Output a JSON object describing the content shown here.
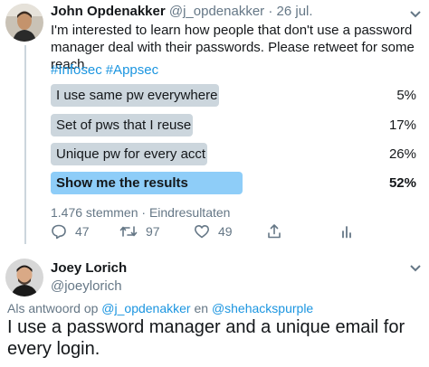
{
  "tweet": {
    "author_name": "John Opdenakker",
    "author_handle": "@j_opdenakker",
    "separator": "·",
    "date": "26 jul.",
    "text": "I'm interested to learn how people that don't use a password manager deal with their passwords. Please retweet for some reach.",
    "hashtags": [
      "#Infosec",
      "#Appsec"
    ],
    "poll": {
      "options": [
        {
          "label": "I use same pw everywhere",
          "percent": "5%",
          "value": 5
        },
        {
          "label": "Set of pws that I reuse",
          "percent": "17%",
          "value": 17
        },
        {
          "label": "Unique pw for every acct",
          "percent": "26%",
          "value": 26
        },
        {
          "label": "Show me the results",
          "percent": "52%",
          "value": 52
        }
      ],
      "meta": "1.476 stemmen · Eindresultaten"
    },
    "actions": {
      "replies": "47",
      "retweets": "97",
      "likes": "49"
    },
    "colors": {
      "accent": "#1b95e0",
      "bar": "#ccd6dd",
      "winner_bar": "#8ecdf8",
      "muted": "#657786"
    }
  },
  "reply": {
    "author_name": "Joey Lorich",
    "author_handle": "@joeylorich",
    "replying_prefix": "Als antwoord op",
    "replying_user1": "@j_opdenakker",
    "replying_conj": "en",
    "replying_user2": "@shehackspurple",
    "text": "I use a password manager and a unique email for every login."
  }
}
